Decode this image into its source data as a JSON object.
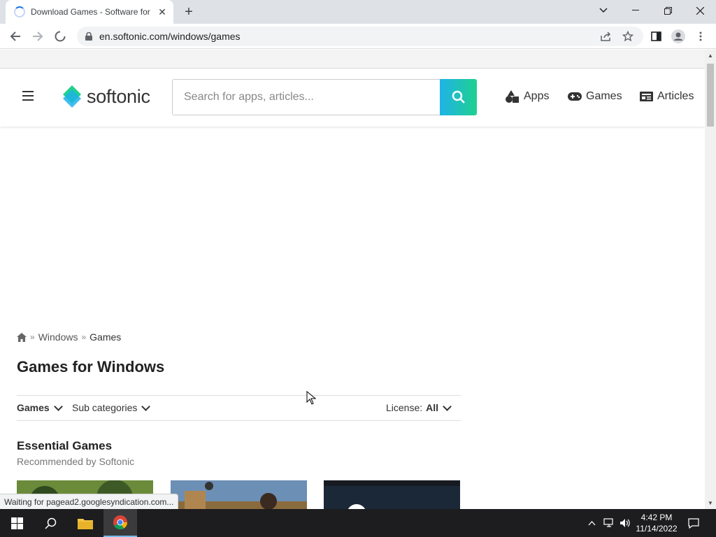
{
  "browser": {
    "tab_title": "Download Games - Software for",
    "url": "en.softonic.com/windows/games",
    "status_text": "Waiting for pagead2.googlesyndication.com..."
  },
  "site": {
    "logo_text": "softonic",
    "search_placeholder": "Search for apps, articles...",
    "nav": {
      "apps": "Apps",
      "games": "Games",
      "articles": "Articles"
    },
    "accent_colors": [
      "#1fb3e9",
      "#1fd08e"
    ]
  },
  "breadcrumb": {
    "home_icon": "home-icon",
    "items": [
      "Windows",
      "Games"
    ],
    "separator": "»"
  },
  "page": {
    "title": "Games for Windows",
    "filters": {
      "games": "Games",
      "subcategories": "Sub categories",
      "license_label": "License:",
      "license_value": "All"
    },
    "section": {
      "title": "Essential Games",
      "subtitle": "Recommended by Softonic"
    }
  },
  "taskbar": {
    "time": "4:42 PM",
    "date": "11/14/2022"
  }
}
